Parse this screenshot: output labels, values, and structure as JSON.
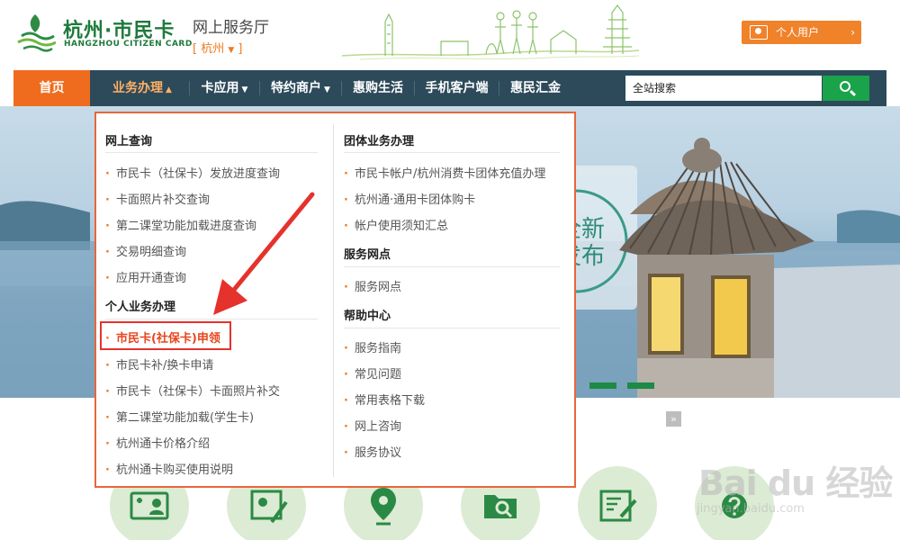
{
  "header": {
    "logo_cn": "杭州·市民卡",
    "logo_en": "HANGZHOU CITIZEN CARD",
    "portal_title": "网上服务厅",
    "city_open": "[ ",
    "city": "杭州",
    "city_close": " ]",
    "user_button": "个人用户"
  },
  "nav": {
    "items": [
      "首页",
      "业务办理",
      "卡应用",
      "特约商户",
      "惠购生活",
      "手机客户端",
      "惠民汇金"
    ],
    "search_placeholder": "全站搜索"
  },
  "banner": {
    "headline_top": "全新",
    "headline_bottom": "发布"
  },
  "dropdown": {
    "left": {
      "sections": [
        {
          "title": "网上查询",
          "items": [
            "市民卡（社保卡）发放进度查询",
            "卡面照片补交查询",
            "第二课堂功能加载进度查询",
            "交易明细查询",
            "应用开通查询"
          ]
        },
        {
          "title": "个人业务办理",
          "items": [
            "市民卡(社保卡)申领",
            "市民卡补/换卡申请",
            "市民卡（社保卡）卡面照片补交",
            "第二课堂功能加载(学生卡)",
            "杭州通卡价格介绍",
            "杭州通卡购买使用说明"
          ]
        }
      ]
    },
    "right": {
      "sections": [
        {
          "title": "团体业务办理",
          "items": [
            "市民卡帐户/杭州消费卡团体充值办理",
            "杭州通·通用卡团体购卡",
            "帐户使用须知汇总"
          ]
        },
        {
          "title": "服务网点",
          "items": [
            "服务网点"
          ]
        },
        {
          "title": "帮助中心",
          "items": [
            "服务指南",
            "常见问题",
            "常用表格下载",
            "网上咨询",
            "服务协议"
          ]
        }
      ]
    }
  },
  "watermark": {
    "text": "Bai du 经验",
    "sub": "jingyan.baidu.com"
  },
  "colors": {
    "brand_green": "#1f7a3c",
    "accent_orange": "#ee7a1e",
    "nav_bg": "#2c4a5a",
    "highlight_red": "#e5322d"
  }
}
